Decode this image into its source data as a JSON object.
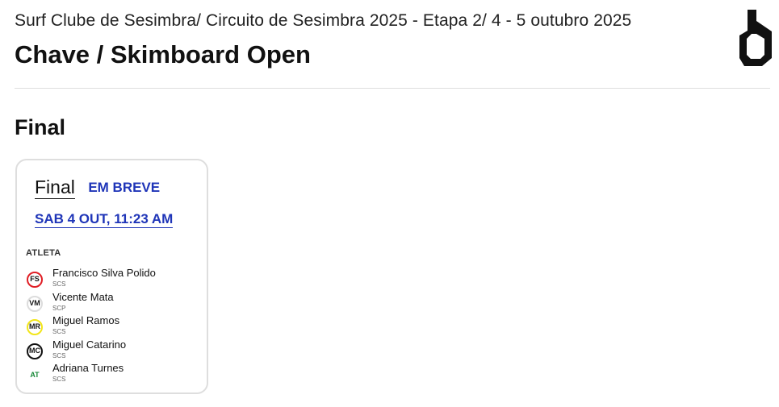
{
  "header": {
    "event": "Surf Clube de Sesimbra/ Circuito de Sesimbra 2025 - Etapa 2/ 4 - 5 outubro 2025",
    "title": "Chave / Skimboard Open",
    "logo_icon": "brand-logo-icon"
  },
  "round": {
    "title": "Final"
  },
  "heat": {
    "name": "Final",
    "status": "EM BREVE",
    "time": "SAB 4 OUT, 11:23 AM",
    "column_header": "ATLETA",
    "accent_color": "#1f35b8",
    "athletes": [
      {
        "initials": "FS",
        "name": "Francisco Silva Polido",
        "club": "SCS",
        "color": "#e01e25"
      },
      {
        "initials": "VM",
        "name": "Vicente Mata",
        "club": "SCP",
        "color": "#dcdcdc"
      },
      {
        "initials": "MR",
        "name": "Miguel Ramos",
        "club": "SCS",
        "color": "#f2e519"
      },
      {
        "initials": "MC",
        "name": "Miguel Catarino",
        "club": "SCS",
        "color": "#111111"
      },
      {
        "initials": "AT",
        "name": "Adriana Turnes",
        "club": "SCS",
        "color": "#1a8a3a"
      }
    ]
  }
}
